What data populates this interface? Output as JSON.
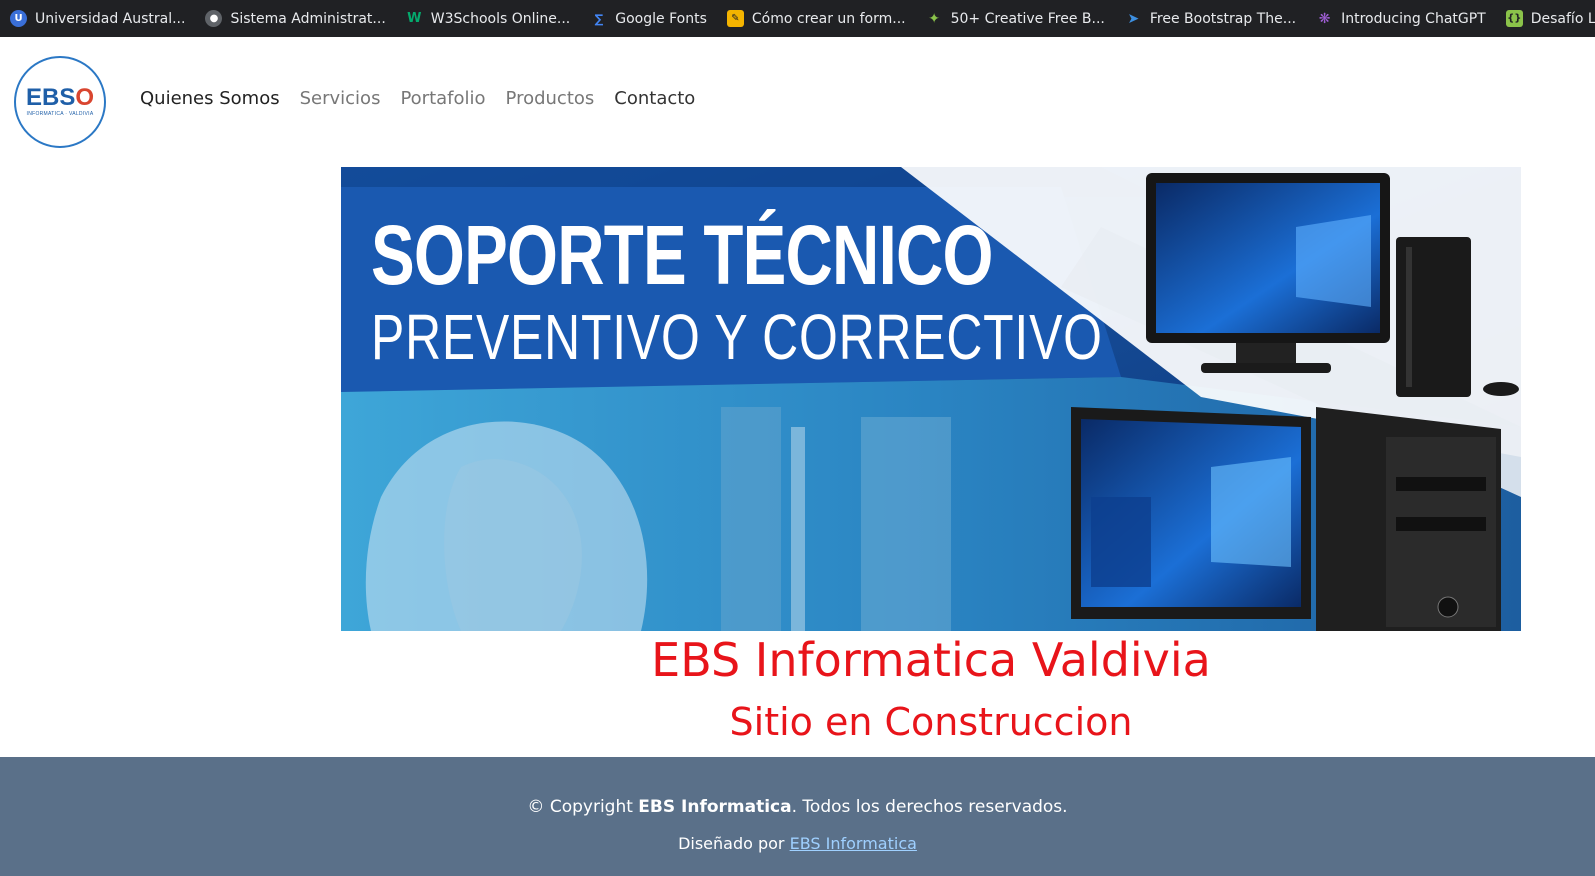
{
  "bookmarks": [
    {
      "label": "Universidad Austral...",
      "icon": "university-icon",
      "color": "#3a6fd8"
    },
    {
      "label": "Sistema Administrat...",
      "icon": "globe-icon",
      "color": "#5f6368"
    },
    {
      "label": "W3Schools Online...",
      "icon": "w3schools-icon",
      "color": "#04aa6d"
    },
    {
      "label": "Google Fonts",
      "icon": "google-fonts-icon",
      "color": "#4285f4"
    },
    {
      "label": "Cómo crear un form...",
      "icon": "tutorial-icon",
      "color": "#f4b400"
    },
    {
      "label": "50+ Creative Free B...",
      "icon": "bird-icon",
      "color": "#8ac34a"
    },
    {
      "label": "Free Bootstrap The...",
      "icon": "bootstrap-icon",
      "color": "#3d8fe0"
    },
    {
      "label": "Introducing ChatGPT",
      "icon": "chatgpt-icon",
      "color": "#a05fd6"
    },
    {
      "label": "Desafío La",
      "icon": "code-icon",
      "color": "#8bc34a"
    }
  ],
  "logo": {
    "mark": "EBS",
    "mark_o": "O",
    "sub": "INFORMATICA · VALDIVIA"
  },
  "nav": [
    {
      "label": "Quienes Somos"
    },
    {
      "label": "Servicios"
    },
    {
      "label": "Portafolio"
    },
    {
      "label": "Productos"
    },
    {
      "label": "Contacto"
    }
  ],
  "hero": {
    "line1": "SOPORTE TÉCNICO",
    "line2": "PREVENTIVO Y CORRECTIVO"
  },
  "titles": {
    "main": "EBS Informatica Valdivia",
    "sub": "Sitio en Construccion"
  },
  "footer": {
    "copy_prefix": "© Copyright ",
    "copy_brand": "EBS Informatica",
    "copy_suffix": ". Todos los derechos reservados.",
    "designed_prefix": "Diseñado por ",
    "designed_link": "EBS Informatica"
  }
}
